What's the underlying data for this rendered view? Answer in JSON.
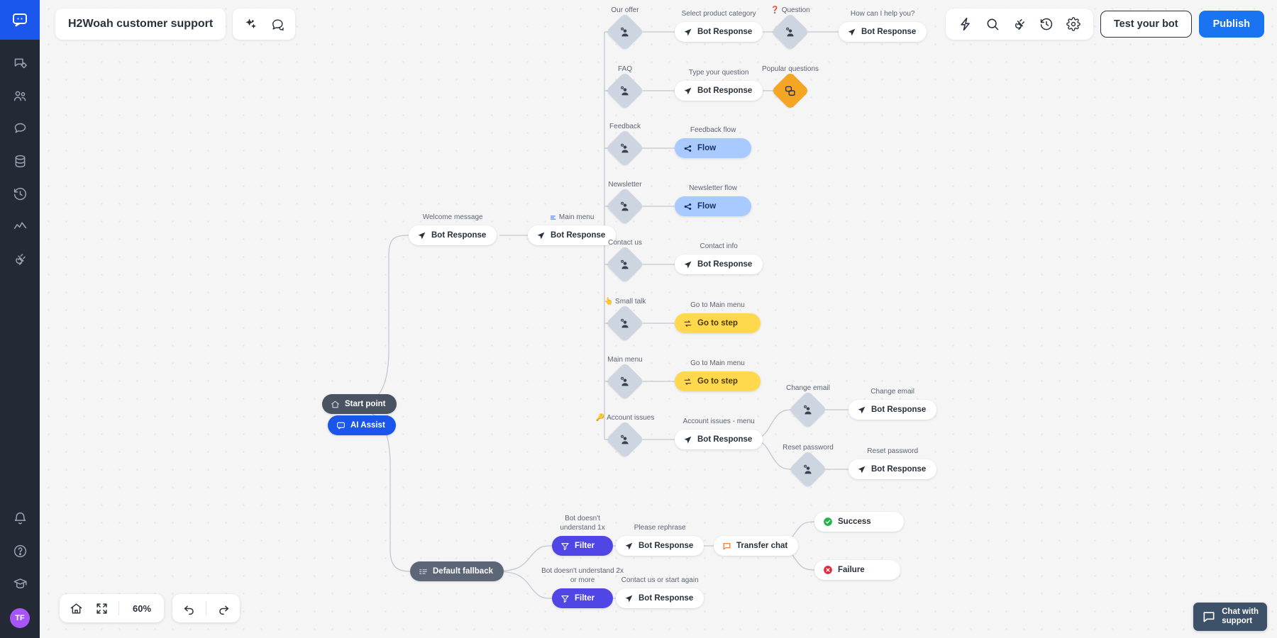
{
  "app": {
    "title": "H2Woah customer support",
    "zoom_level": "60%",
    "accent_color": "#1a56eb",
    "canvas_bg": "#f5f5f6"
  },
  "sidebar": {
    "logo_icon": "chatbot-logo-icon",
    "items": [
      {
        "icon": "chat-settings-icon",
        "name": "chat-settings"
      },
      {
        "icon": "users-icon",
        "name": "users"
      },
      {
        "icon": "speech-bubble-icon",
        "name": "chats"
      },
      {
        "icon": "database-icon",
        "name": "database"
      },
      {
        "icon": "history-icon",
        "name": "history"
      },
      {
        "icon": "analytics-icon",
        "name": "analytics"
      },
      {
        "icon": "plug-icon",
        "name": "integrations"
      }
    ],
    "bottom_items": [
      {
        "icon": "bell-icon",
        "name": "notifications"
      },
      {
        "icon": "help-circle-icon",
        "name": "help"
      },
      {
        "icon": "graduation-cap-icon",
        "name": "academy"
      }
    ],
    "avatar_initials": "TF"
  },
  "titlebar": {
    "ai_icon": "sparkles-icon",
    "help_icon": "chat-question-icon"
  },
  "toolbar": {
    "icons": [
      {
        "icon": "lightning-icon",
        "name": "actions"
      },
      {
        "icon": "search-icon",
        "name": "search"
      },
      {
        "icon": "plug-icon",
        "name": "integrations"
      },
      {
        "icon": "history-icon",
        "name": "version-history"
      },
      {
        "icon": "gear-icon",
        "name": "settings"
      }
    ],
    "test_label": "Test your bot",
    "publish_label": "Publish"
  },
  "bottom_controls": {
    "home_icon": "home-icon",
    "fit_icon": "fit-screen-icon",
    "zoom_value": "60%",
    "undo_icon": "undo-icon",
    "redo_icon": "redo-icon"
  },
  "chat_support": {
    "icon": "chat-bubble-icon",
    "line1": "Chat with",
    "line2": "support"
  },
  "nodes": {
    "start_point": {
      "label": "Start point",
      "icon": "home-icon"
    },
    "ai_assist": {
      "label": "AI Assist",
      "icon": "chat-ai-icon"
    },
    "welcome_caption": "Welcome message",
    "welcome_label": "Bot Response",
    "mainmenu_caption": "Main menu",
    "mainmenu_caption_icon": "menu-list-icon",
    "mainmenu_label": "Bot Response",
    "default_fallback": {
      "label": "Default fallback",
      "icon": "fallback-icon"
    },
    "branches": [
      {
        "caption": "Our offer",
        "emoji": "",
        "step_caption": "Select product category",
        "step_label": "Bot Response",
        "step_type": "bot-response",
        "extra_caption": "Question",
        "extra_emoji": "❓",
        "extra2_caption": "How can I help you?",
        "extra2_label": "Bot Response"
      },
      {
        "caption": "FAQ",
        "emoji": "",
        "step_caption": "Type your question",
        "step_label": "Bot Response",
        "step_type": "bot-response",
        "extra_caption": "Popular questions",
        "extra_type": "orange-diamond"
      },
      {
        "caption": "Feedback",
        "emoji": "",
        "step_caption": "Feedback flow",
        "step_label": "Flow",
        "step_type": "flow"
      },
      {
        "caption": "Newsletter",
        "emoji": "",
        "step_caption": "Newsletter flow",
        "step_label": "Flow",
        "step_type": "flow"
      },
      {
        "caption": "Contact us",
        "emoji": "",
        "step_caption": "Contact info",
        "step_label": "Bot Response",
        "step_type": "bot-response"
      },
      {
        "caption": "Small talk",
        "emoji": "👆",
        "step_caption": "Go to Main menu",
        "step_label": "Go to step",
        "step_type": "goto"
      },
      {
        "caption": "Main menu",
        "emoji": "",
        "step_caption": "Go to Main menu",
        "step_label": "Go to step",
        "step_type": "goto"
      },
      {
        "caption": "Account issues",
        "emoji": "🔑",
        "step_caption": "Account issues - menu",
        "step_label": "Bot Response",
        "step_type": "bot-response"
      }
    ],
    "account_sub": [
      {
        "caption": "Change email",
        "step_caption": "Change email",
        "step_label": "Bot Response"
      },
      {
        "caption": "Reset password",
        "step_caption": "Reset password",
        "step_label": "Bot Response"
      }
    ],
    "fallback_branches": [
      {
        "caption": "Bot doesn't understand 1x",
        "filter_label": "Filter",
        "step_caption": "Please rephrase",
        "step_label": "Bot Response"
      },
      {
        "caption": "Bot doesn't understand 2x or more",
        "filter_label": "Filter",
        "step_caption": "Contact us or start again",
        "step_label": "Bot Response"
      }
    ],
    "transfer": {
      "label": "Transfer chat",
      "icon": "transfer-chat-icon"
    },
    "outcomes": [
      {
        "label": "Success",
        "icon": "check-circle-icon",
        "color": "#22b14c"
      },
      {
        "label": "Failure",
        "icon": "x-circle-icon",
        "color": "#e0283c"
      }
    ]
  }
}
